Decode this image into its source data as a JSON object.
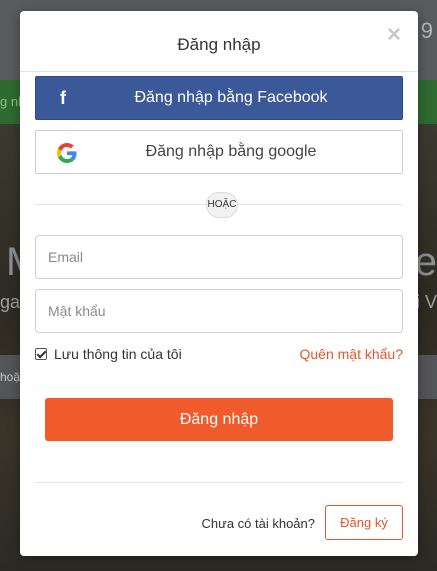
{
  "background": {
    "corner_number": "9",
    "green_bar_text": "g nh",
    "stripe_text": "hoặ",
    "big_text_left": "M",
    "big_text_right": "ne",
    "small_text_left": "gay",
    "small_text_right": "i V"
  },
  "modal": {
    "title": "Đăng nhập",
    "close_icon": "close-icon",
    "facebook_button": {
      "icon": "facebook-icon",
      "label": "Đăng nhập bằng Facebook"
    },
    "google_button": {
      "icon": "google-icon",
      "label": "Đăng nhập bằng google"
    },
    "or_label": "HOẶC",
    "email": {
      "placeholder": "Email",
      "value": ""
    },
    "password": {
      "placeholder": "Mật khẩu",
      "value": ""
    },
    "remember": {
      "label": "Lưu thông tin của tôi",
      "checked": true
    },
    "forgot_link": "Quên mật khẩu?",
    "login_button": "Đăng nhập",
    "no_account_text": "Chưa có tài khoản?",
    "register_button": "Đăng ký"
  },
  "colors": {
    "facebook": "#3b5998",
    "accent": "#f15a2b",
    "link": "#e2572b"
  }
}
